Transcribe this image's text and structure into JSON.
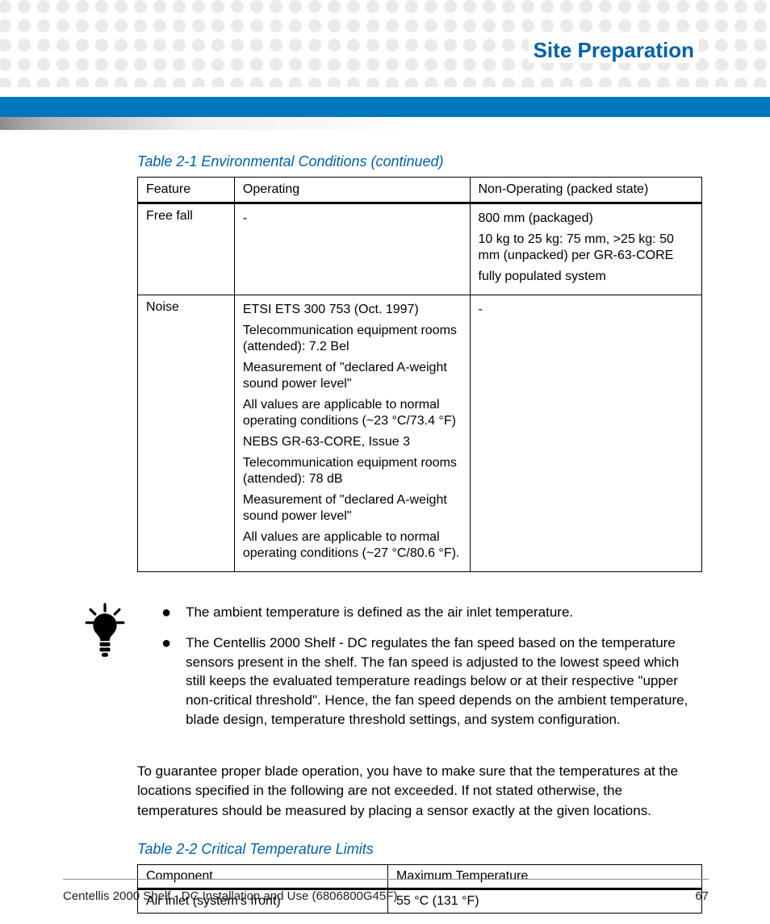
{
  "header": {
    "section_title": "Site Preparation"
  },
  "table1": {
    "caption": "Table 2-1 Environmental Conditions (continued)",
    "headers": {
      "feature": "Feature",
      "operating": "Operating",
      "non_operating": "Non-Operating (packed state)"
    },
    "rows": [
      {
        "feature": "Free fall",
        "operating": [
          "-"
        ],
        "non_operating": [
          "800 mm (packaged)",
          "10 kg to 25 kg: 75 mm, >25 kg: 50 mm (unpacked) per GR-63-CORE",
          "fully populated system"
        ]
      },
      {
        "feature": "Noise",
        "operating": [
          "ETSI ETS 300 753 (Oct. 1997)",
          "Telecommunication equipment rooms (attended): 7.2 Bel",
          "Measurement of \"declared A-weight sound power level\"",
          "All values are applicable to normal operating conditions (~23 °C/73.4 °F)",
          "NEBS GR-63-CORE, Issue 3",
          "Telecommunication equipment rooms (attended): 78 dB",
          "Measurement of \"declared A-weight sound power level\"",
          "All values are applicable to normal operating conditions (~27 °C/80.6 °F)."
        ],
        "non_operating": [
          "-"
        ]
      }
    ]
  },
  "tip": {
    "bullets": [
      "The ambient temperature is defined as the air inlet temperature.",
      "The Centellis 2000 Shelf - DC regulates the fan speed based on the temperature sensors present in the shelf. The fan speed is adjusted to the lowest speed which still keeps the evaluated temperature readings below or at their respective \"upper non-critical threshold\". Hence, the fan speed depends on the ambient temperature, blade design, temperature threshold settings, and system configuration."
    ]
  },
  "paragraph": "To guarantee proper blade operation, you have to make sure that the temperatures at the locations specified in the following are not exceeded. If not stated otherwise, the temperatures should be measured by placing a sensor exactly at the given locations.",
  "table2": {
    "caption": "Table 2-2 Critical Temperature Limits",
    "headers": {
      "component": "Component",
      "max_temp": "Maximum Temperature"
    },
    "rows": [
      {
        "component": "Air inlet (system's front)",
        "max_temp": "55 °C (131 °F)"
      }
    ]
  },
  "footer": {
    "doc": "Centellis 2000 Shelf - DC Installation and Use (6806800G45F)",
    "page": "67"
  }
}
